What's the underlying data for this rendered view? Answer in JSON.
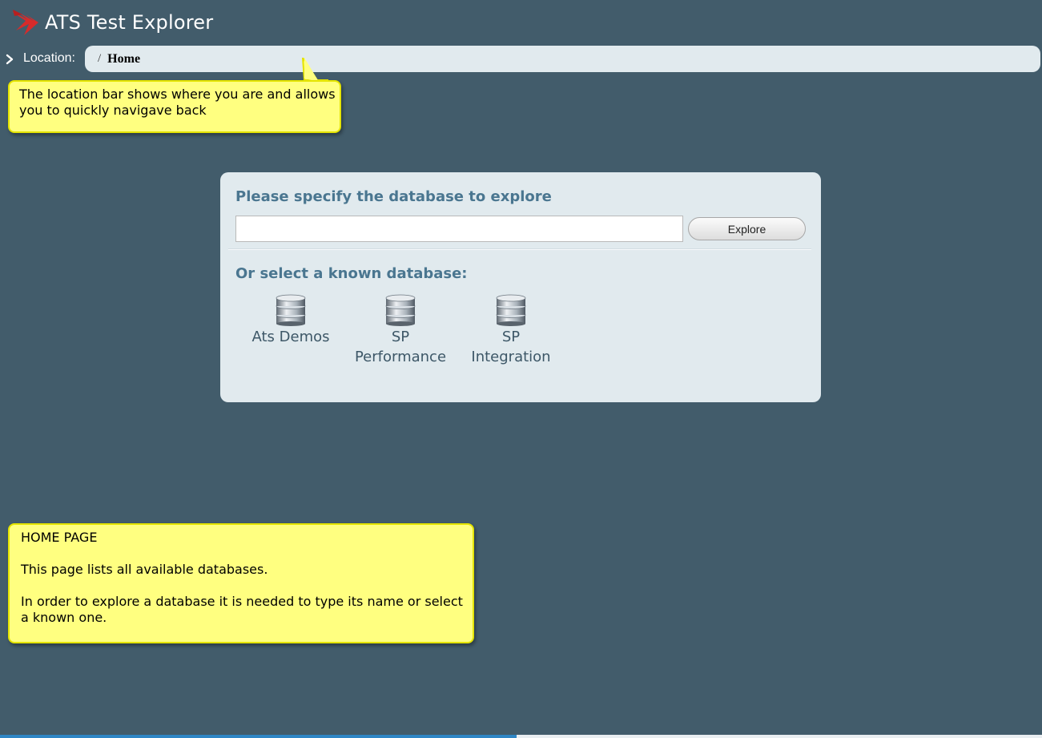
{
  "header": {
    "title": "ATS Test Explorer",
    "logo_icon": "ats-logo-icon",
    "logo_color": "#d62b2b"
  },
  "location": {
    "label": "Location:",
    "separator": "/",
    "current": "Home",
    "toggle_icon": "chevron-right-icon"
  },
  "tooltips": {
    "location_hint": "The location bar shows where you are and allows you to quickly navigave back",
    "home": {
      "title": "HOME PAGE",
      "line1": "This page lists all available databases.",
      "line2": "In order to explore a database it is needed to type its name or select a known one."
    },
    "background": "#ffff80"
  },
  "panel": {
    "specify_heading": "Please specify the database to explore",
    "input_value": "",
    "explore_label": "Explore",
    "known_heading": "Or select a known database:",
    "heading_color": "#4a7690",
    "databases": [
      {
        "label_line1": "Ats Demos",
        "label_line2": "",
        "icon": "database-icon"
      },
      {
        "label_line1": "SP",
        "label_line2": "Performance",
        "icon": "database-icon"
      },
      {
        "label_line1": "SP",
        "label_line2": "Integration",
        "icon": "database-icon"
      }
    ]
  },
  "colors": {
    "background": "#425c6b",
    "panel": "#e1eaee",
    "accent": "#2f86c5"
  }
}
